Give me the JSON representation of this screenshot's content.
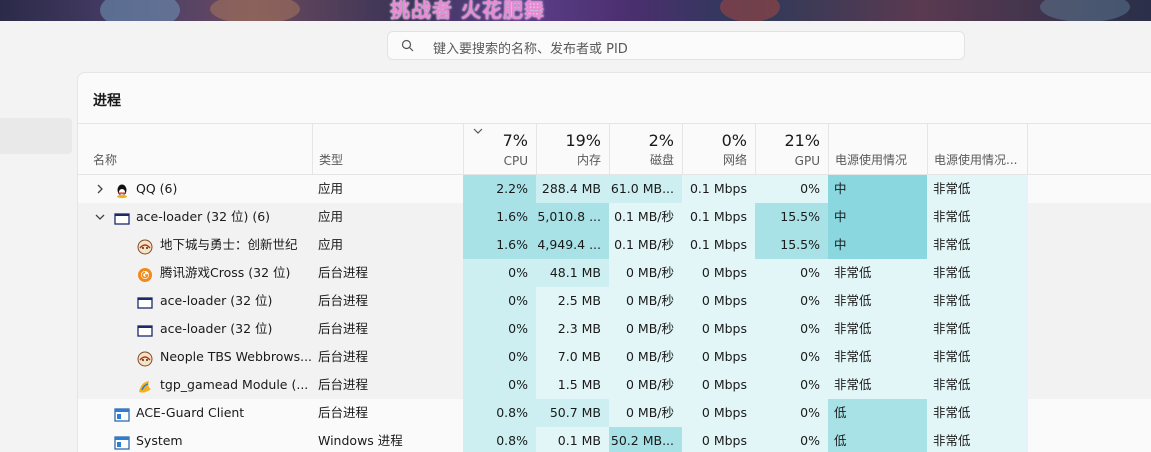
{
  "banner": {
    "text": "挑战者 火花肥舞"
  },
  "search": {
    "placeholder": "键入要搜索的名称、发布者或 PID"
  },
  "panel": {
    "title": "进程"
  },
  "columns": {
    "name": "名称",
    "type": "类型",
    "cpu": {
      "pct": "7%",
      "label": "CPU"
    },
    "memory": {
      "pct": "19%",
      "label": "内存"
    },
    "disk": {
      "pct": "2%",
      "label": "磁盘"
    },
    "network": {
      "pct": "0%",
      "label": "网络"
    },
    "gpu": {
      "pct": "21%",
      "label": "GPU"
    },
    "power": "电源使用情况",
    "power_trend": "电源使用情况..."
  },
  "rows": [
    {
      "name": "QQ (6)",
      "type": "应用",
      "cpu": "2.2%",
      "memory": "288.4 MB",
      "disk": "61.0 MB...",
      "network": "0.1 Mbps",
      "gpu": "0%",
      "power": "中",
      "power_trend": "非常低",
      "icon": "qq-icon",
      "expand": "right"
    },
    {
      "name": "ace-loader (32 位) (6)",
      "type": "应用",
      "cpu": "1.6%",
      "memory": "5,010.8 ...",
      "disk": "0.1 MB/秒",
      "network": "0.1 Mbps",
      "gpu": "15.5%",
      "power": "中",
      "power_trend": "非常低",
      "icon": "window-icon",
      "expand": "down"
    },
    {
      "name": "地下城与勇士：创新世纪",
      "type": "应用",
      "cpu": "1.6%",
      "memory": "4,949.4 ...",
      "disk": "0.1 MB/秒",
      "network": "0.1 Mbps",
      "gpu": "15.5%",
      "power": "中",
      "power_trend": "非常低",
      "icon": "dnf-icon",
      "child": true
    },
    {
      "name": "腾讯游戏Cross (32 位)",
      "type": "后台进程",
      "cpu": "0%",
      "memory": "48.1 MB",
      "disk": "0 MB/秒",
      "network": "0 Mbps",
      "gpu": "0%",
      "power": "非常低",
      "power_trend": "非常低",
      "icon": "tencent-cross-icon",
      "child": true
    },
    {
      "name": "ace-loader (32 位)",
      "type": "后台进程",
      "cpu": "0%",
      "memory": "2.5 MB",
      "disk": "0 MB/秒",
      "network": "0 Mbps",
      "gpu": "0%",
      "power": "非常低",
      "power_trend": "非常低",
      "icon": "window-icon",
      "child": true
    },
    {
      "name": "ace-loader (32 位)",
      "type": "后台进程",
      "cpu": "0%",
      "memory": "2.3 MB",
      "disk": "0 MB/秒",
      "network": "0 Mbps",
      "gpu": "0%",
      "power": "非常低",
      "power_trend": "非常低",
      "icon": "window-icon",
      "child": true
    },
    {
      "name": "Neople TBS Webbrows...",
      "type": "后台进程",
      "cpu": "0%",
      "memory": "7.0 MB",
      "disk": "0 MB/秒",
      "network": "0 Mbps",
      "gpu": "0%",
      "power": "非常低",
      "power_trend": "非常低",
      "icon": "dnf-icon",
      "child": true
    },
    {
      "name": "tgp_gamead Module (...",
      "type": "后台进程",
      "cpu": "0%",
      "memory": "1.5 MB",
      "disk": "0 MB/秒",
      "network": "0 Mbps",
      "gpu": "0%",
      "power": "非常低",
      "power_trend": "非常低",
      "icon": "tgp-icon",
      "child": true
    },
    {
      "name": "ACE-Guard Client",
      "type": "后台进程",
      "cpu": "0.8%",
      "memory": "50.7 MB",
      "disk": "0 MB/秒",
      "network": "0 Mbps",
      "gpu": "0%",
      "power": "低",
      "power_trend": "非常低",
      "icon": "app-window-icon"
    },
    {
      "name": "System",
      "type": "Windows 进程",
      "cpu": "0.8%",
      "memory": "0.1 MB",
      "disk": "50.2 MB...",
      "network": "0 Mbps",
      "gpu": "0%",
      "power": "低",
      "power_trend": "非常低",
      "icon": "app-window-icon"
    }
  ],
  "heat": {
    "cpu": [
      "h3",
      "h3",
      "h3",
      "h2",
      "h2",
      "h2",
      "h2",
      "h2",
      "h2",
      "h2"
    ],
    "memory": [
      "h2",
      "h3",
      "h3",
      "h2",
      "h1",
      "h1",
      "h1",
      "h1",
      "h2",
      "h1"
    ],
    "disk": [
      "h2",
      "h1",
      "h1",
      "h1",
      "h1",
      "h1",
      "h1",
      "h1",
      "h1",
      "h3"
    ],
    "network": [
      "h1",
      "h1",
      "h1",
      "h1",
      "h1",
      "h1",
      "h1",
      "h1",
      "h1",
      "h1"
    ],
    "gpu": [
      "h1",
      "h3",
      "h3",
      "h1",
      "h1",
      "h1",
      "h1",
      "h1",
      "h1",
      "h1"
    ],
    "power": [
      "h4",
      "h4",
      "h4",
      "h1",
      "h1",
      "h1",
      "h1",
      "h1",
      "h3",
      "h3"
    ],
    "power_trend": [
      "h1",
      "h1",
      "h1",
      "h1",
      "h1",
      "h1",
      "h1",
      "h1",
      "h1",
      "h1"
    ]
  },
  "colors": {
    "accent": "#8ad7df",
    "heat_light": "#e3f6f7"
  }
}
